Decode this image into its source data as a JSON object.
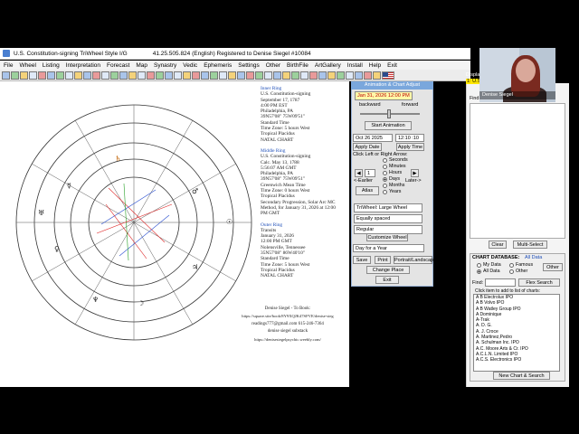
{
  "window": {
    "title": "U.S. Constitution-signing TriWheel Style  I/G",
    "version_text": "41.25.505.824  (English) Registered to Denise Siegel #10084"
  },
  "menu": [
    "File",
    "Wheel",
    "Listing",
    "Interpretation",
    "Forecast",
    "Map",
    "Synastry",
    "Vedic",
    "Ephemeris",
    "Settings",
    "Other",
    "BirthFile",
    "ArtGallery",
    "Install",
    "Help",
    "Exit"
  ],
  "chart_text": {
    "inner": {
      "heading": "Inner Ring",
      "lines": [
        "U.S. Constitution-signing",
        "September 17, 1787",
        "4:00 PM EST",
        "Philadelphia, PA",
        "39N57'08\"  75W09'51\"",
        "Standard Time",
        "Time Zone: 5 hours West",
        "Tropical Placidus",
        "NATAL CHART"
      ]
    },
    "middle": {
      "heading": "Middle Ring",
      "lines": [
        "U.S. Constitution-signing",
        "Calc. May 13, 1788",
        "5:56:07 AM GMT",
        "Philadelphia, PA",
        "39N57'08\"  75W09'51\"",
        "Greenwich Mean Time",
        "Time Zone: 0 hours West",
        "Tropical Placidus",
        "Secondary Progression, Solar Arc MC",
        "Method,  for January 31, 2026 at 12:00",
        "PM GMT"
      ]
    },
    "outer": {
      "heading": "Outer Ring",
      "lines": [
        "Transits",
        "January 31, 2026",
        "12:00 PM GMT",
        "Nolensville, Tennessee",
        "35N57'08\"  86W40'10\"",
        "Standard Time",
        "Time Zone: 5 hours West",
        "Tropical Placidus",
        "NATAL CHART"
      ]
    }
  },
  "footer": {
    "line1": "Denise Siegel - To Book:",
    "line2": "https://square.site/book/8Y9XQJK47SFVE/denise-sieg",
    "line3": "readings777@gmail.com      615-246-7364",
    "line4": "denise siegel substack",
    "line5": "https://denisesiegelpsychic.weebly.com/"
  },
  "animation_panel": {
    "title": "Animation & Chart Adjust",
    "date_display": "Jan 31, 2026  12:00 PM",
    "backward": "backward",
    "forward": "forward",
    "start_button": "Start Animation",
    "date_field": "Oct 26 2025",
    "time_field": "12:10 :10",
    "apply_date": "Apply Date",
    "apply_time": "Apply Time",
    "click_label": "Click Left or Right Arrow:",
    "left_label": "<-Earlier",
    "right_label": "Later->",
    "step_value": "1",
    "atlas": "Atlas",
    "units": [
      "Seconds",
      "Minutes",
      "Hours",
      "Days",
      "Months",
      "Years"
    ],
    "selected_unit": "Days",
    "wheel_select": "TriWheel: Large Wheel",
    "spacing_select": "Equally spaced",
    "style_select": "Regular",
    "customize": "Customize Wheel",
    "period_select": "Day for a Year",
    "save": "Save",
    "print": "Print",
    "portrait": "Portrait/Landscap",
    "change_place": "Change Place",
    "exit": "Exit"
  },
  "right_panel": {
    "display_label": "Display",
    "tag": "1: U.S.",
    "find_label": "Find",
    "clear": "Clear",
    "multi_select": "Multi-Select",
    "db_title": "CHART DATABASE:",
    "db_all": "All Data",
    "radio_options": [
      "My Data",
      "Famous",
      "All Data",
      "Other"
    ],
    "selected": "All Data",
    "other_button": "Other",
    "find2": "Find:",
    "flex_search": "Flex Search",
    "list_caption": "Click item to add to list of charts:",
    "charts": [
      "A B Electrolux  IPO",
      "A B Volvo IPO",
      "A B Watley Group IPO",
      "A Dominique",
      "A-Trak",
      "A. D. G.",
      "A. J. Croce",
      "A. Martinez,Pedro",
      "A. Schulman Inc.  IPO",
      "A.C. Moore Arts & Cr.  IPO",
      "A.C.L.N. Limited  IPO",
      "A.C.S. Electronics  IPO"
    ],
    "new_chart": "New Chart & Search"
  },
  "video": {
    "name": "Denise Siegel"
  },
  "colors": {
    "panel_accent": "#7aa7dc",
    "date_bg": "#fff8a8",
    "date_text": "#b00000",
    "heading_blue": "#1f4fb8"
  }
}
